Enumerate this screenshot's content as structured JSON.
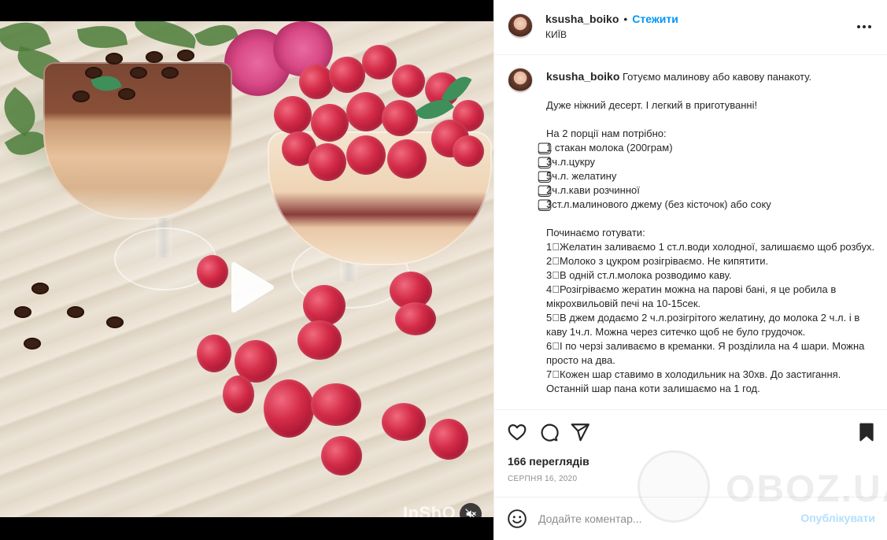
{
  "header": {
    "username": "ksusha_boiko",
    "separator": "•",
    "follow_label": "Стежити",
    "location": "КИЇВ"
  },
  "caption": {
    "username": "ksusha_boiko",
    "intro": "Готуємо малинову або кавову панакоту.",
    "lines": [
      "Дуже ніжний десерт. І легкий в приготуванні!",
      "",
      "На 2 порції нам потрібно:",
      "⃣1 стакан молока (200грам)",
      "⃣3ч.л.цукру",
      "⃣5ч.л. желатину",
      "⃣2ч.л.кави розчинної",
      "⃣3ст.л.малинового джему (без кісточок) або соку",
      "",
      "Починаємо готувати:",
      "1⃣Желатин заливаємо 1 ст.л.води холодної, залишаємо щоб розбух.",
      "2⃣Молоко з цукром розігріваємо. Не кипятити.",
      "3⃣В одній ст.л.молока розводимо каву.",
      "4⃣Розігріваємо жератин можна на парові бані, я це робила в мікрохвильовій печі на 10-15сек.",
      "5⃣В джем додаємо 2 ч.л.розігрітого желатину, до молока 2 ч.л. і в каву 1ч.л. Можна через ситечко щоб не було грудочок.",
      "6⃣І по черзі заливаємо в креманки. Я розділила на 4 шари. Можна просто на два.",
      "7⃣Кожен шар ставимо в холодильник на 30хв. До застигання. Останній шар пана коти залишаємо на 1 год."
    ]
  },
  "stats": {
    "views": "166 переглядів",
    "date": "СЕРПНЯ 16, 2020"
  },
  "comment": {
    "placeholder": "Додайте коментар...",
    "publish_label": "Опублікувати"
  },
  "media": {
    "watermark": "InShO"
  },
  "watermark": {
    "text": "OBOZ.UA"
  },
  "icons": {
    "like": "heart-icon",
    "comment": "comment-icon",
    "share": "paper-plane-icon",
    "save": "bookmark-icon",
    "more": "more-horizontal-icon",
    "emoji": "emoji-icon",
    "play": "play-icon",
    "mute": "muted-speaker-icon"
  },
  "colors": {
    "accent": "#0095f6",
    "publish_disabled": "#b2dffc",
    "text": "#262626",
    "muted": "#8e8e8e"
  }
}
